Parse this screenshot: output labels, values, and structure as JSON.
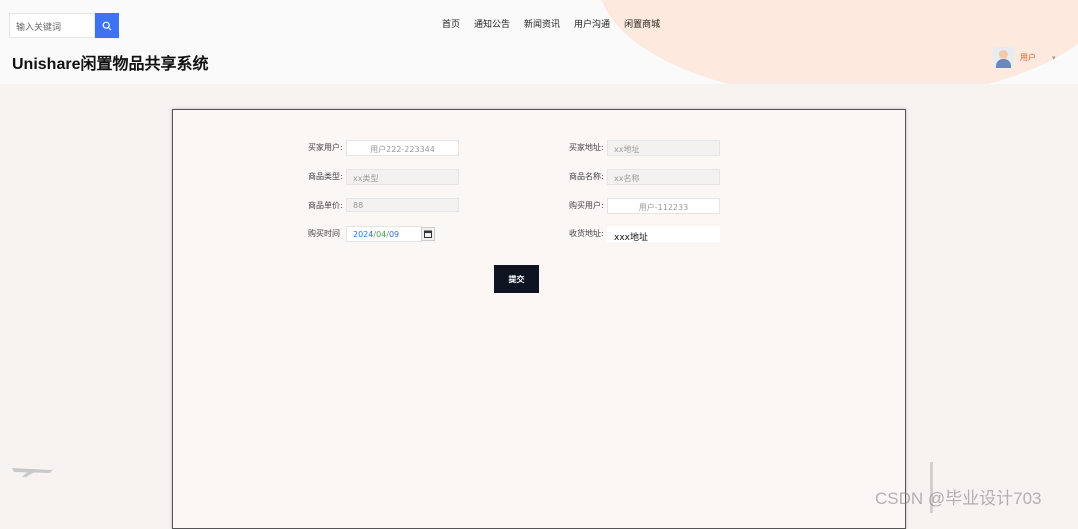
{
  "header": {
    "search_placeholder": "输入关键词",
    "nav": [
      "首页",
      "通知公告",
      "新闻资讯",
      "用户沟通",
      "闲置商城"
    ],
    "site_title": "Unishare闲置物品共享系统",
    "user_label": "用户",
    "user_caret": "▾"
  },
  "form": {
    "buyer_user": {
      "label": "买家用户:",
      "value": "用户222-223344"
    },
    "buyer_address": {
      "label": "买家地址:",
      "value": "xx地址"
    },
    "product_type": {
      "label": "商品类型:",
      "value": "xx类型"
    },
    "product_name": {
      "label": "商品名称:",
      "value": "xx名称"
    },
    "unit_price": {
      "label": "商品单价:",
      "value": "88"
    },
    "seller_user": {
      "label": "购买用户:",
      "value": "用户-112233"
    },
    "purchase_time": {
      "label": "购买时间",
      "year": "2024",
      "month": "04",
      "day": "09",
      "sep": "/"
    },
    "shipping_address": {
      "label": "收货地址:",
      "value": "xxx地址"
    },
    "submit_label": "提交"
  },
  "watermark": "CSDN @毕业设计703",
  "colors": {
    "accent_blue": "#3d73f3",
    "submit_bg": "#0e1422",
    "user_orange": "#e0632a",
    "header_blob": "#fde9dd"
  }
}
